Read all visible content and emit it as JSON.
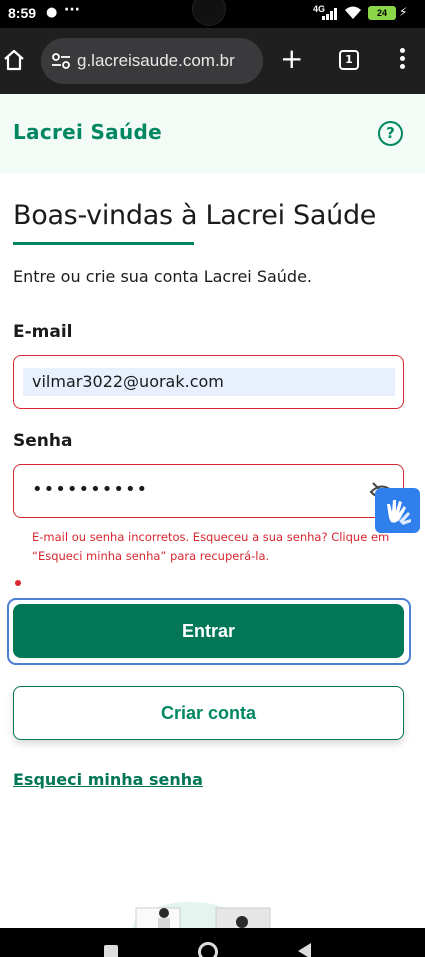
{
  "status_bar": {
    "time": "8:59",
    "network": "4G",
    "battery": "24"
  },
  "browser": {
    "url": "g.lacreisaude.com.br",
    "tab_count": "1",
    "icons": [
      "home-icon",
      "site-settings-icon",
      "plus-icon",
      "tabs-icon",
      "menu-icon"
    ]
  },
  "header": {
    "logo": "Lacrei Saúde",
    "help": "?"
  },
  "main": {
    "title": "Boas-vindas à Lacrei Saúde",
    "subtitle": "Entre ou crie sua conta Lacrei Saúde.",
    "email": {
      "label": "E-mail",
      "value": "vilmar3022@uorak.com"
    },
    "password": {
      "label": "Senha",
      "value": "••••••••••"
    },
    "error": "E-mail ou senha incorretos. Esqueceu a sua senha? Clique em “Esqueci minha senha” para recuperá-la.",
    "login_button": "Entrar",
    "create_button": "Criar conta",
    "forgot_link": "Esqueci minha senha"
  },
  "colors": {
    "brand": "#018762",
    "button": "#027758",
    "error": "#d6262f",
    "focus": "#4a7fd2"
  }
}
